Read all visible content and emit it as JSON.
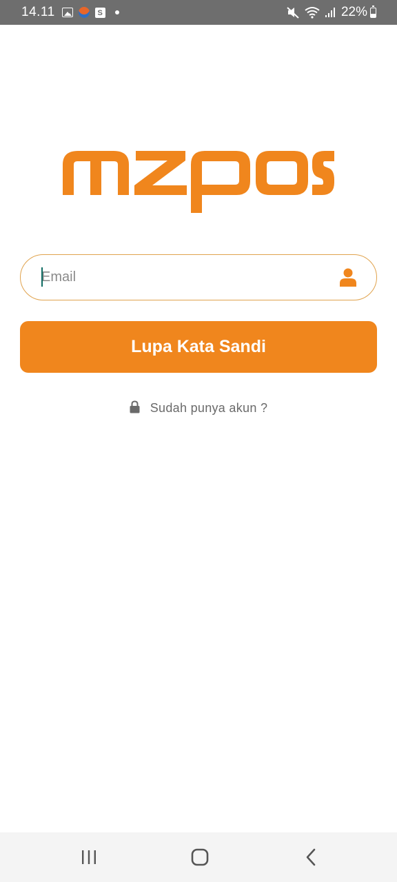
{
  "status_bar": {
    "time": "14.11",
    "battery_percent": "22%",
    "left_icons": [
      "gallery-icon",
      "app-notification-icon",
      "shop-icon",
      "dot-icon"
    ],
    "right_icons": [
      "mute-icon",
      "wifi-icon",
      "signal-icon",
      "battery-icon"
    ]
  },
  "logo": {
    "text": "mzpos",
    "color": "#f0861d"
  },
  "email_field": {
    "placeholder": "Email",
    "value": "",
    "icon": "user-icon"
  },
  "forgot_button": {
    "label": "Lupa Kata Sandi",
    "background": "#f0861d"
  },
  "login_link": {
    "icon": "lock-icon",
    "label": "Sudah punya akun ?"
  },
  "nav_bar": {
    "buttons": [
      "recent-apps-icon",
      "home-icon",
      "back-icon"
    ]
  }
}
